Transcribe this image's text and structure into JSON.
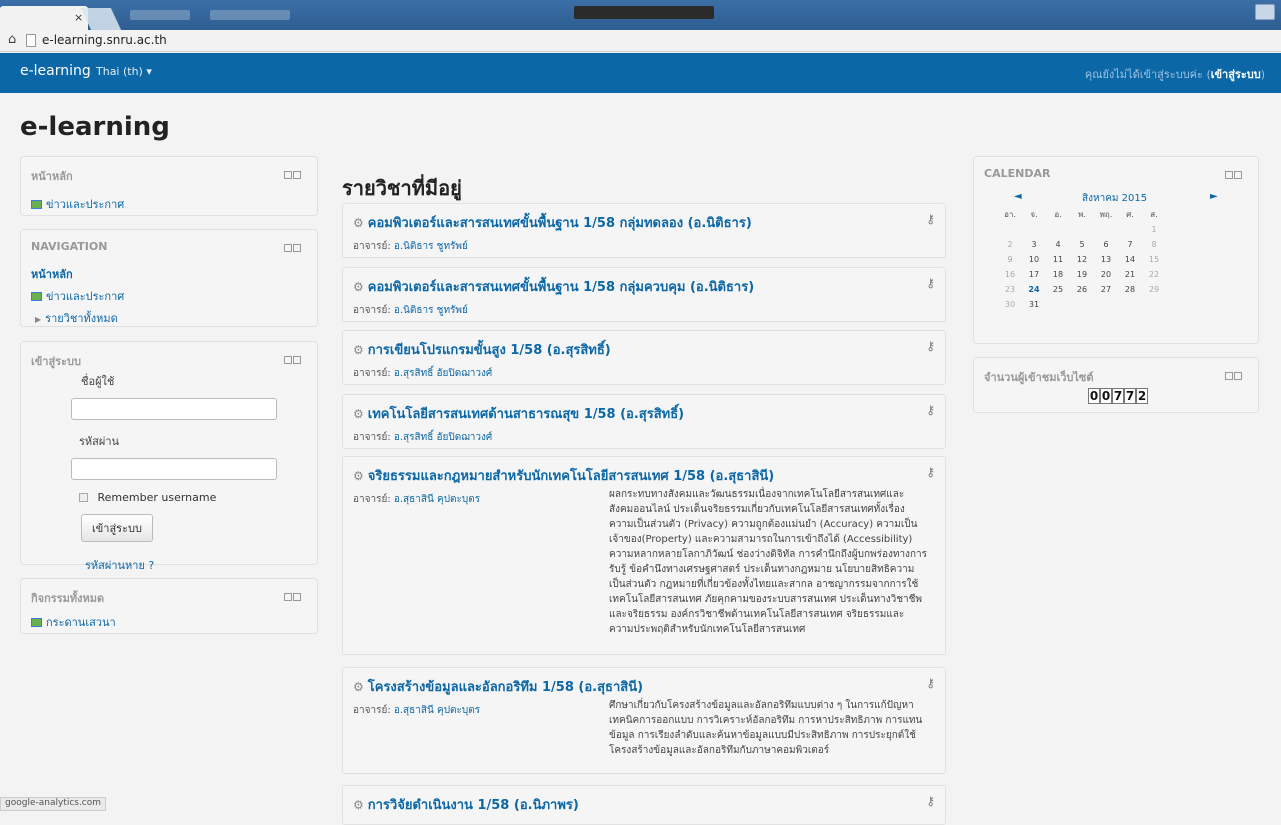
{
  "browser": {
    "tab_close": "×",
    "url": "e-learning.snru.ac.th"
  },
  "navbar": {
    "brand": "e-learning",
    "language": "Thai (th) ▾",
    "login_text": "คุณยังไม่ได้เข้าสู่ระบบค่ะ (",
    "login_link": "เข้าสู่ระบบ",
    "login_close": ")"
  },
  "page_heading": "e-learning",
  "blocks": {
    "main_menu": {
      "title": "หน้าหลัก",
      "news": "ข่าวและประกาศ"
    },
    "navigation": {
      "title": "NAVIGATION",
      "home": "หน้าหลัก",
      "news": "ข่าวและประกาศ",
      "all_courses": "รายวิชาทั้งหมด"
    },
    "login": {
      "title": "เข้าสู่ระบบ",
      "username_label": "ชื่อผู้ใช้",
      "password_label": "รหัสผ่าน",
      "remember": "Remember username",
      "submit": "เข้าสู่ระบบ",
      "forgot": "รหัสผ่านหาย ?"
    },
    "activities": {
      "title": "กิจกรรมทั้งหมด",
      "forum": "กระดานเสวนา"
    },
    "calendar": {
      "title": "CALENDAR",
      "month": "สิงหาคม 2015",
      "prev": "◄",
      "next": "►",
      "weekdays": [
        "อา.",
        "จ.",
        "อ.",
        "พ.",
        "พฤ.",
        "ศ.",
        "ส."
      ],
      "weeks": [
        [
          "",
          "",
          "",
          "",
          "",
          "",
          "1"
        ],
        [
          "2",
          "3",
          "4",
          "5",
          "6",
          "7",
          "8"
        ],
        [
          "9",
          "10",
          "11",
          "12",
          "13",
          "14",
          "15"
        ],
        [
          "16",
          "17",
          "18",
          "19",
          "20",
          "21",
          "22"
        ],
        [
          "23",
          "24",
          "25",
          "26",
          "27",
          "28",
          "29"
        ],
        [
          "30",
          "31",
          "",
          "",
          "",
          "",
          ""
        ]
      ],
      "today": "24"
    },
    "visitors": {
      "title": "จำนวนผู้เข้าชมเว็บไซต์",
      "digits": [
        "0",
        "0",
        "7",
        "7",
        "2"
      ]
    }
  },
  "main": {
    "heading": "รายวิชาที่มีอยู่",
    "teacher_label": "อาจารย์: ",
    "courses": [
      {
        "title": "คอมพิวเตอร์และสารสนเทศขั้นพื้นฐาน 1/58 กลุ่มทดลอง (อ.นิติธาร)",
        "teacher": "อ.นิติธาร ชูทรัพย์"
      },
      {
        "title": "คอมพิวเตอร์และสารสนเทศขั้นพื้นฐาน 1/58 กลุ่มควบคุม (อ.นิติธาร)",
        "teacher": "อ.นิติธาร ชูทรัพย์"
      },
      {
        "title": "การเขียนโปรแกรมขั้นสูง 1/58 (อ.สุรสิทธิ์)",
        "teacher": "อ.สุรสิทธิ์ อัยปิดฌาวงศ์"
      },
      {
        "title": "เทคโนโลยีสารสนเทศด้านสาธารณสุข 1/58 (อ.สุรสิทธิ์)",
        "teacher": "อ.สุรสิทธิ์ อัยปิดฌาวงศ์"
      },
      {
        "title": "จริยธรรมและกฎหมายสำหรับนักเทคโนโลยีสารสนเทศ 1/58 (อ.สุธาสินี)",
        "teacher": "อ.สุธาสินี คุปตะบุตร",
        "summary": "ผลกระทบทางสังคมและวัฒนธรรมเนื่องจากเทคโนโลยีสารสนเทศและสังคมออนไลน์ ประเด็นจริยธรรมเกี่ยวกับเทคโนโลยีสารสนเทศทั้งเรื่องความเป็นส่วนตัว (Privacy) ความถูกต้องแม่นยำ (Accuracy) ความเป็นเจ้าของ(Property) และความสามารถในการเข้าถึงได้ (Accessibility) ความหลากหลายโลกาภิวัฒน์ ช่องว่างดิจิทัล การคำนึกถึงผู้บกพร่องทางการรับรู้ ข้อคำนึงทางเศรษฐศาสตร์ ประเด็นทางกฎหมาย นโยบายสิทธิความเป็นส่วนตัว กฎหมายที่เกี่ยวข้องทั้งไทยและสากล อาชญากรรมจากการใช้เทคโนโลยีสารสนเทศ ภัยคุกคามของระบบสารสนเทศ ประเด็นทางวิชาชีพและจริยธรรม องค์กรวิชาชีพด้านเทคโนโลยีสารสนเทศ จริยธรรมและความประพฤติสำหรับนักเทคโนโลยีสารสนเทศ"
      },
      {
        "title": "โครงสร้างข้อมูลและอัลกอริทึม 1/58 (อ.สุธาสินี)",
        "teacher": "อ.สุธาสินี คุปตะบุตร",
        "summary": "ศึกษาเกี่ยวกับโครงสร้างข้อมูลและอัลกอริทึมแบบต่าง ๆ ในการแก้ปัญหา เทคนิคการออกแบบ การวิเคราะห์อัลกอริทึม การหาประสิทธิภาพ การแทนข้อมูล การเรียงลำดับและค้นหาข้อมูลแบบมีประสิทธิภาพ การประยุกต์ใช้โครงสร้างข้อมูลและอัลกอริทึมกับภาษาคอมพิวเตอร์"
      },
      {
        "title": "การวิจัยดำเนินงาน 1/58 (อ.นิภาพร)",
        "teacher": ""
      }
    ]
  },
  "status_bar": "google-analytics.com"
}
